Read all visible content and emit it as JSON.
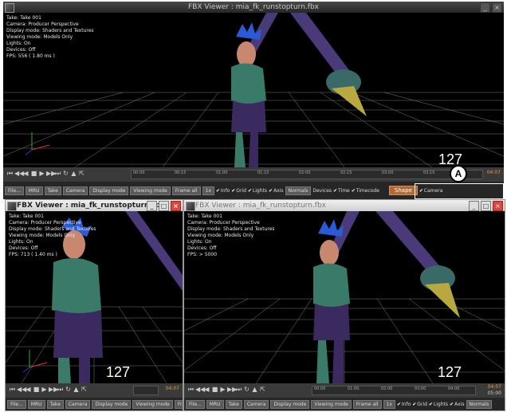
{
  "main_window": {
    "title": "FBX Viewer : mia_fk_runstopturn.fbx",
    "info": [
      "Take: Take 001",
      "Camera: Producer Perspective",
      "Display mode: Shaders and Textures",
      "Viewing mode: Models Only",
      "Lights: On",
      "Devices: Off",
      "FPS: 556 ( 1.80 ms )"
    ],
    "frame_number": "127",
    "frame_readout": "04:07",
    "timeline_ticks": [
      "00:00",
      "00:15",
      "01:00",
      "01:15",
      "02:00",
      "02:15",
      "03:00",
      "03:15",
      "04:07"
    ],
    "toolbar_buttons": [
      "File...",
      "MRU",
      "Take",
      "Camera",
      "Display mode",
      "Viewing mode",
      "Frame all"
    ],
    "speed": "1x",
    "checkboxes": [
      "Info",
      "Grid",
      "Lights",
      "Axis"
    ],
    "normals": "Normals",
    "checkboxes2": [
      "Devices",
      "Time",
      "Timecode"
    ],
    "shape": "Shape",
    "camera_chk": "Camera",
    "callout_label": "A",
    "callout_number": "127"
  },
  "left_window": {
    "title": "FBX Viewer : mia_fk_runstopturn.fbx",
    "info": [
      "Take: Take 001",
      "Camera: Producer Perspective",
      "Display mode: Shaders and Textures",
      "Viewing mode: Models Only",
      "Lights: On",
      "Devices: Off",
      "FPS: 713 ( 1.40 ms )"
    ],
    "frame_number": "127",
    "frame_readout": "04:07",
    "toolbar_buttons": [
      "File...",
      "MRU",
      "Take",
      "Camera",
      "Display mode",
      "Viewing mode",
      "Frame a"
    ]
  },
  "right_window": {
    "title": "FBX Viewer : mia_fk_runstopturn.fbx",
    "info": [
      "Take: Take 001",
      "Camera: Producer Perspective",
      "Display mode: Shaders and Textures",
      "Viewing mode: Models Only",
      "Lights: On",
      "Devices: Off",
      "FPS: > 5000"
    ],
    "frame_number": "127",
    "frame_readout": "04:07",
    "end_time": "05:00",
    "timeline_ticks": [
      "00:00",
      "01:00",
      "02:00",
      "03:00",
      "04:00"
    ],
    "toolbar_buttons": [
      "File...",
      "MRU",
      "Take",
      "Camera",
      "Display mode",
      "Viewing mode",
      "Frame all"
    ],
    "speed": "1x",
    "checkboxes": [
      "Info",
      "Grid",
      "Lights",
      "Axis"
    ],
    "normals": "Normals"
  },
  "colors": {
    "accent": "#b06a38",
    "background": "#000000",
    "toolbar": "#262626"
  }
}
